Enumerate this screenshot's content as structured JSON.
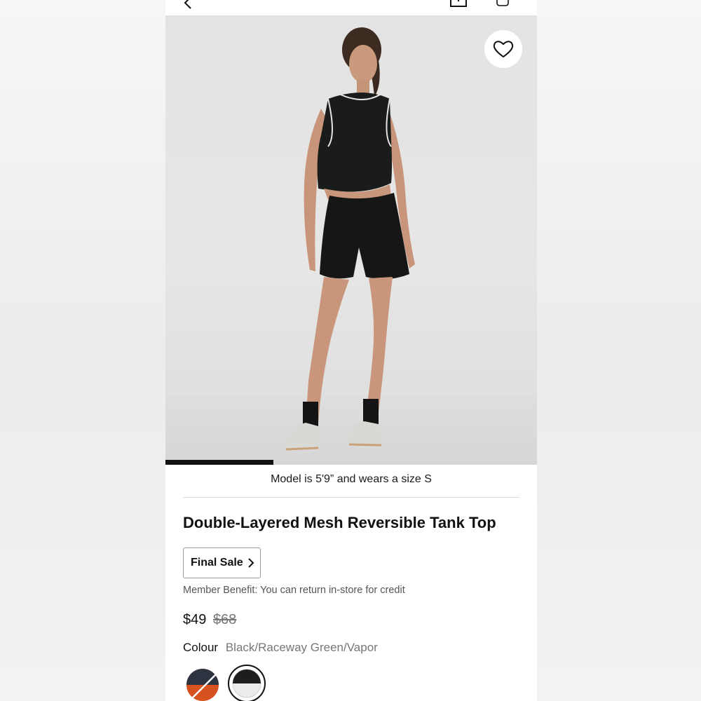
{
  "hero": {
    "caption": "Model is 5'9” and wears a size S",
    "gallery_progress": 0.29
  },
  "product": {
    "title": "Double-Layered Mesh Reversible Tank Top",
    "final_sale_label": "Final Sale",
    "member_benefit": "Member Benefit: You can return in-store for credit",
    "price": "$49",
    "original_price": "$68",
    "colour_label": "Colour",
    "colour_value": "Black/Raceway Green/Vapor"
  },
  "swatches": [
    {
      "name": "navy-orange",
      "colors": [
        "#2c3442",
        "#d6521e"
      ]
    },
    {
      "name": "black-vapor",
      "colors": [
        "#1d1d1d",
        "#ececec"
      ],
      "selected": true
    }
  ],
  "icons": {
    "back": "back-arrow-icon",
    "share": "share-icon",
    "bag": "bag-icon",
    "favorite": "heart-icon",
    "chevron": "chevron-right-icon"
  }
}
